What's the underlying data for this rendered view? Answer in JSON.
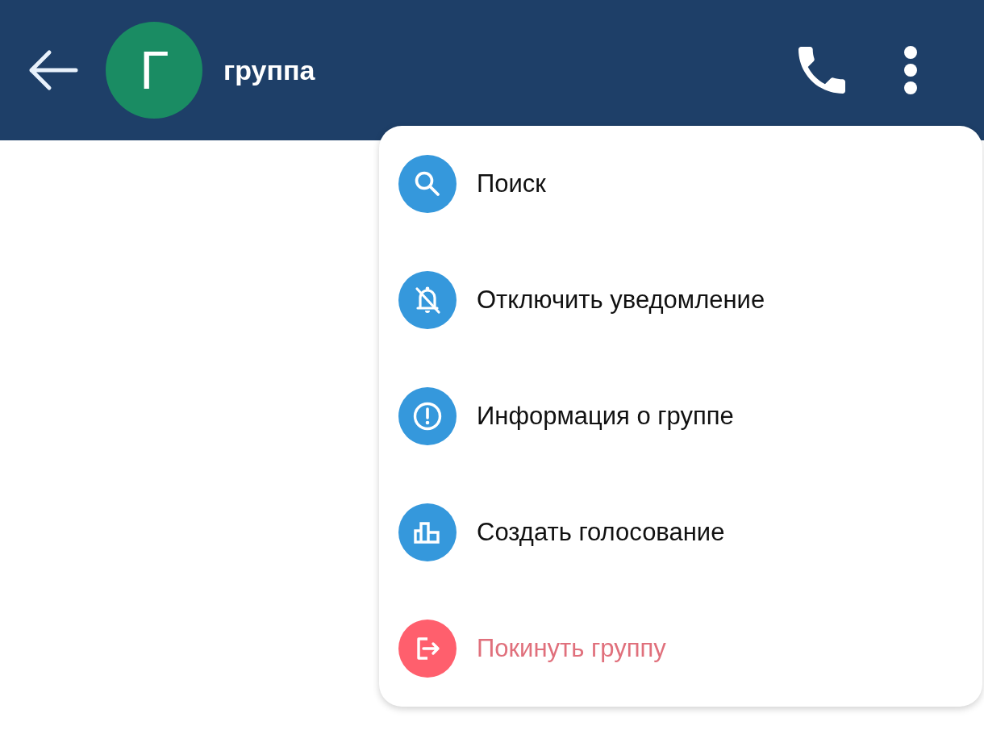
{
  "header": {
    "avatar_letter": "Г",
    "title": "группа"
  },
  "menu": {
    "items": [
      {
        "label": "Поиск",
        "kind": "normal"
      },
      {
        "label": "Отключить уведомление",
        "kind": "normal"
      },
      {
        "label": "Информация о группе",
        "kind": "normal"
      },
      {
        "label": "Создать голосование",
        "kind": "normal"
      },
      {
        "label": "Покинуть группу",
        "kind": "danger"
      }
    ]
  }
}
